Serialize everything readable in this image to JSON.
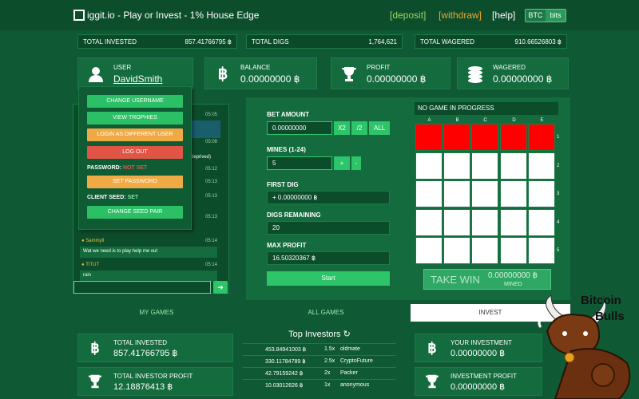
{
  "header": {
    "title": "iggit.io - Play or Invest - 1% House Edge",
    "links": {
      "deposit": "[deposit]",
      "withdraw": "[withdraw]",
      "help": "[help]"
    },
    "unit_toggle": {
      "btc": "BTC",
      "bits": "bits"
    }
  },
  "stats": {
    "total_invested": {
      "label": "TOTAL INVESTED",
      "value": "857.41766795 ฿"
    },
    "total_digs": {
      "label": "TOTAL DIGS",
      "value": "1,764,621"
    },
    "total_wagered": {
      "label": "TOTAL WAGERED",
      "value": "910.66526803 ฿"
    }
  },
  "cards": {
    "user": {
      "label": "USER",
      "value": "DavidSmith"
    },
    "balance": {
      "label": "BALANCE",
      "value": "0.00000000 ฿"
    },
    "profit": {
      "label": "PROFIT",
      "value": "0.00000000 ฿"
    },
    "wagered": {
      "label": "WAGERED",
      "value": "0.00000000 ฿"
    }
  },
  "user_menu": {
    "change_username": "CHANGE USERNAME",
    "view_trophies": "VIEW TROPHIES",
    "login_different": "LOGIN AS DIFFERENT USER",
    "logout": "LOG OUT",
    "password_label": "PASSWORD:",
    "password_status": "NOT SET",
    "set_password": "SET PASSWORD",
    "client_seed_label": "CLIENT SEED:",
    "client_seed_status": "SET",
    "change_seed": "CHANGE SEED PAIR"
  },
  "chat": {
    "times": [
      "05:05",
      "05:08",
      "05:12",
      "05:13",
      "05:13",
      "05:13",
      "05:14",
      "05:14"
    ],
    "messages": [
      {
        "user": "Sammyll",
        "text": "Wat we need is to play help me out"
      },
      {
        "user": "TITUT",
        "text": "rain"
      }
    ],
    "partial_text": "Deprived)"
  },
  "controls": {
    "bet_amount_label": "BET AMOUNT",
    "bet_amount_value": "0.00000000",
    "x2": "X2",
    "half": "/2",
    "all": "ALL",
    "mines_label": "MINES (1-24)",
    "mines_value": "5",
    "plus": "+",
    "minus": "-",
    "first_dig_label": "FIRST DIG",
    "first_dig_value": "+ 0.00000000 ฿",
    "digs_remaining_label": "DIGS REMAINING",
    "digs_remaining_value": "20",
    "max_profit_label": "MAX PROFIT",
    "max_profit_value": "16.50320367 ฿",
    "start": "Start"
  },
  "grid": {
    "status": "NO GAME IN PROGRESS",
    "columns": [
      "A",
      "B",
      "C",
      "D",
      "E"
    ],
    "rows": [
      "1",
      "2",
      "3",
      "4",
      "5"
    ],
    "red_row": 1,
    "take_win_label": "TAKE WIN",
    "take_win_value": "0.00000000 ฿",
    "take_win_sub": "MINED"
  },
  "tabs": {
    "my_games": "MY GAMES",
    "all_games": "ALL GAMES",
    "invest": "INVEST"
  },
  "invest": {
    "total_invested": {
      "label": "TOTAL INVESTED",
      "value": "857.41766795 ฿"
    },
    "total_investor_profit": {
      "label": "TOTAL INVESTOR PROFIT",
      "value": "12.18876413 ฿"
    },
    "your_investment": {
      "label": "YOUR INVESTMENT",
      "value": "0.00000000 ฿"
    },
    "investment_profit": {
      "label": "INVESTMENT PROFIT",
      "value": "0.00000000 ฿"
    },
    "top_title": "Top Investors ↻",
    "top_investors": [
      {
        "amount": "453.84941003 ฿",
        "mult": "1.5x",
        "name": "oldmate"
      },
      {
        "amount": "330.11784789 ฿",
        "mult": "2.5x",
        "name": "CryptoFuture"
      },
      {
        "amount": "42.79159242 ฿",
        "mult": "2x",
        "name": "Packer"
      },
      {
        "amount": "10.03012626 ฿",
        "mult": "1x",
        "name": "anonymous"
      }
    ]
  },
  "bull_logo": {
    "line1": "Bitcoin",
    "line2": "Bulls"
  },
  "colors": {
    "bg": "#0f5a34",
    "accent": "#2ec46a",
    "mine_red": "#ff0000"
  }
}
